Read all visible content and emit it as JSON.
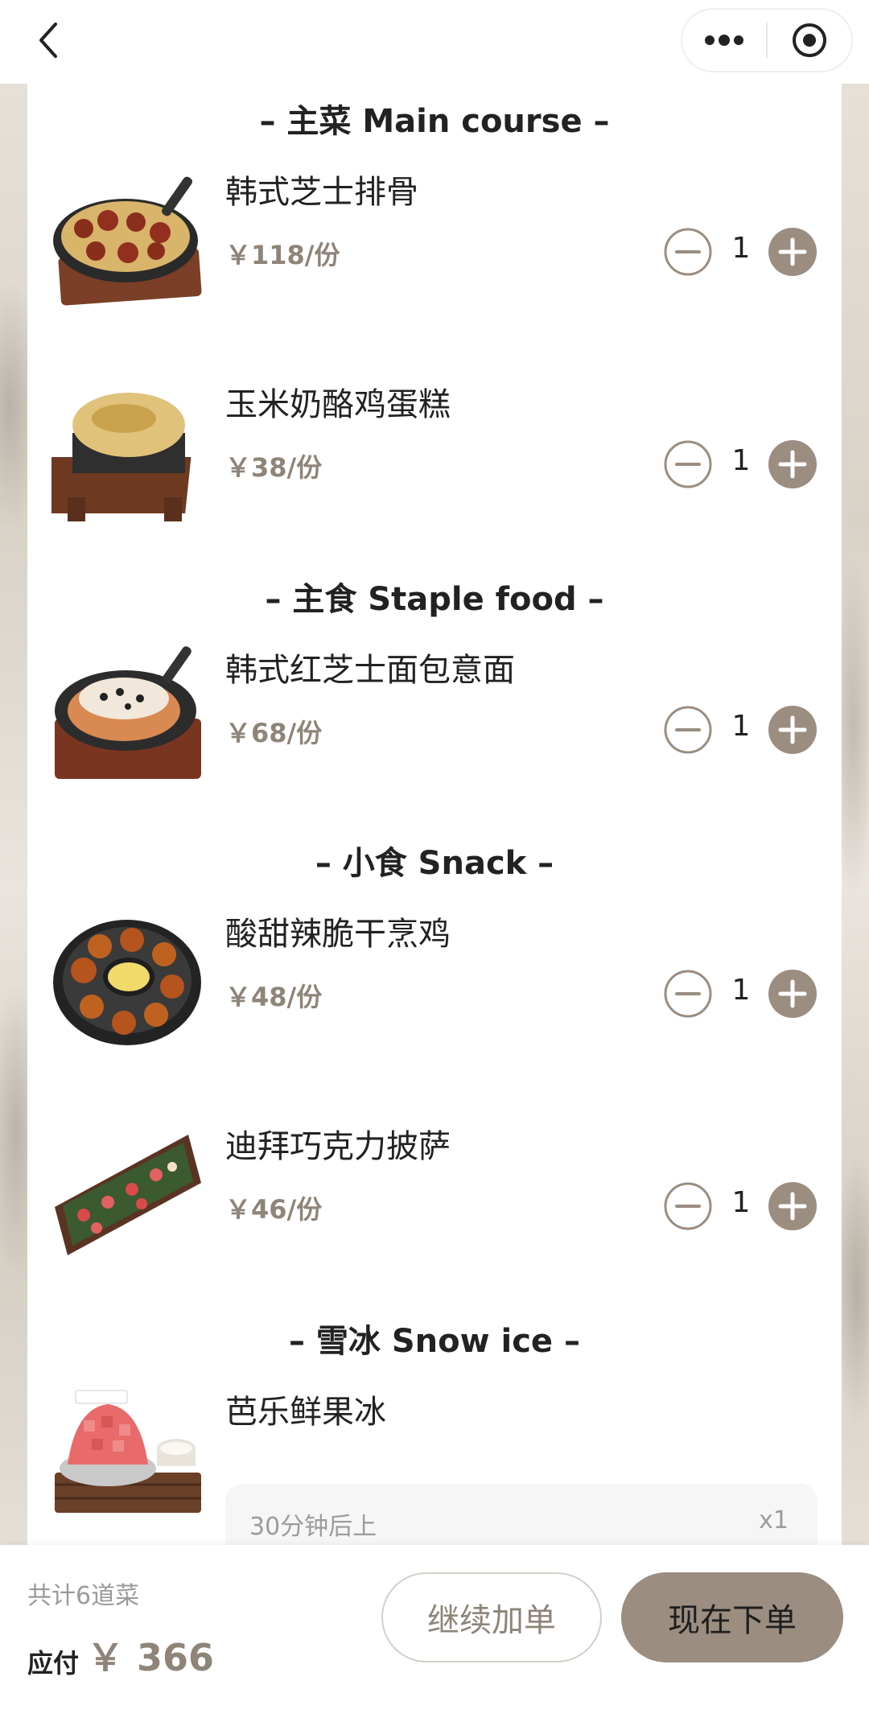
{
  "nav": {
    "back_icon": "chevron-left-icon",
    "more_icon": "more-dots-icon",
    "close_icon": "target-circle-icon"
  },
  "sections": [
    {
      "title": "– 主菜 Main course –"
    },
    {
      "title": "– 主食 Staple food –"
    },
    {
      "title": "– 小食 Snack –"
    },
    {
      "title": "– 雪冰 Snow ice –"
    }
  ],
  "dishes": [
    {
      "name": "韩式芝士排骨",
      "price": "￥118/份",
      "qty": "1"
    },
    {
      "name": "玉米奶酪鸡蛋糕",
      "price": "￥38/份",
      "qty": "1"
    },
    {
      "name": "韩式红芝士面包意面",
      "price": "￥68/份",
      "qty": "1"
    },
    {
      "name": "酸甜辣脆干烹鸡",
      "price": "￥48/份",
      "qty": "1"
    },
    {
      "name": "迪拜巧克力披萨",
      "price": "￥46/份",
      "qty": "1"
    },
    {
      "name": "芭乐鲜果冰",
      "note": "30分钟后上",
      "note_qty": "x1"
    }
  ],
  "footer": {
    "total_count": "共计6道菜",
    "pay_label": "应付",
    "pay_amount": "￥ 366",
    "continue_label": "继续加单",
    "order_label": "现在下单"
  },
  "colors": {
    "accent": "#9b8d80",
    "price": "#8e8478"
  }
}
